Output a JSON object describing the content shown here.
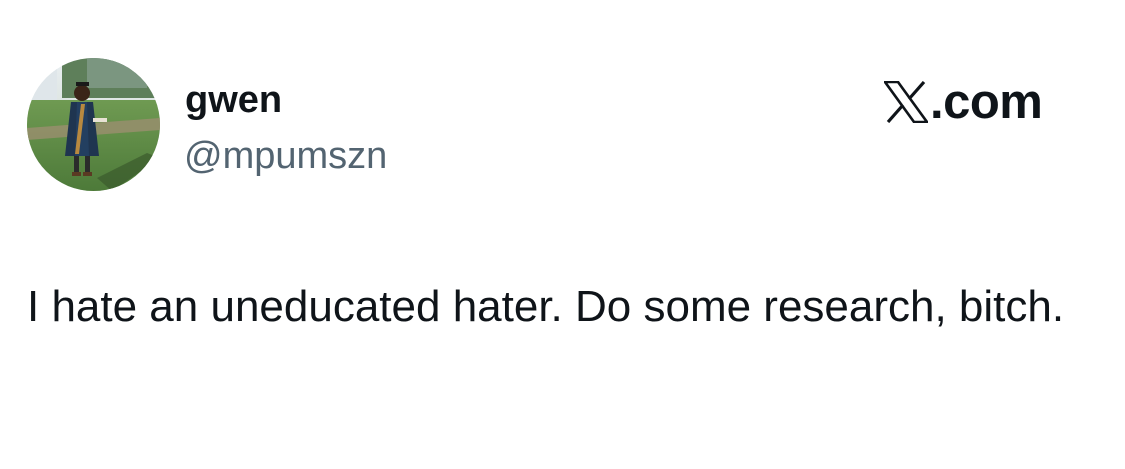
{
  "author": {
    "display_name": "gwen",
    "handle": "@mpumszn",
    "avatar_icon": "profile-photo"
  },
  "brand": {
    "icon": "x-logo-icon",
    "domain_text": ".com"
  },
  "tweet": {
    "text": "I hate an uneducated hater. Do some research, bitch."
  },
  "colors": {
    "background": "#ffffff",
    "primary_text": "#0f1419",
    "secondary_text": "#536471"
  }
}
